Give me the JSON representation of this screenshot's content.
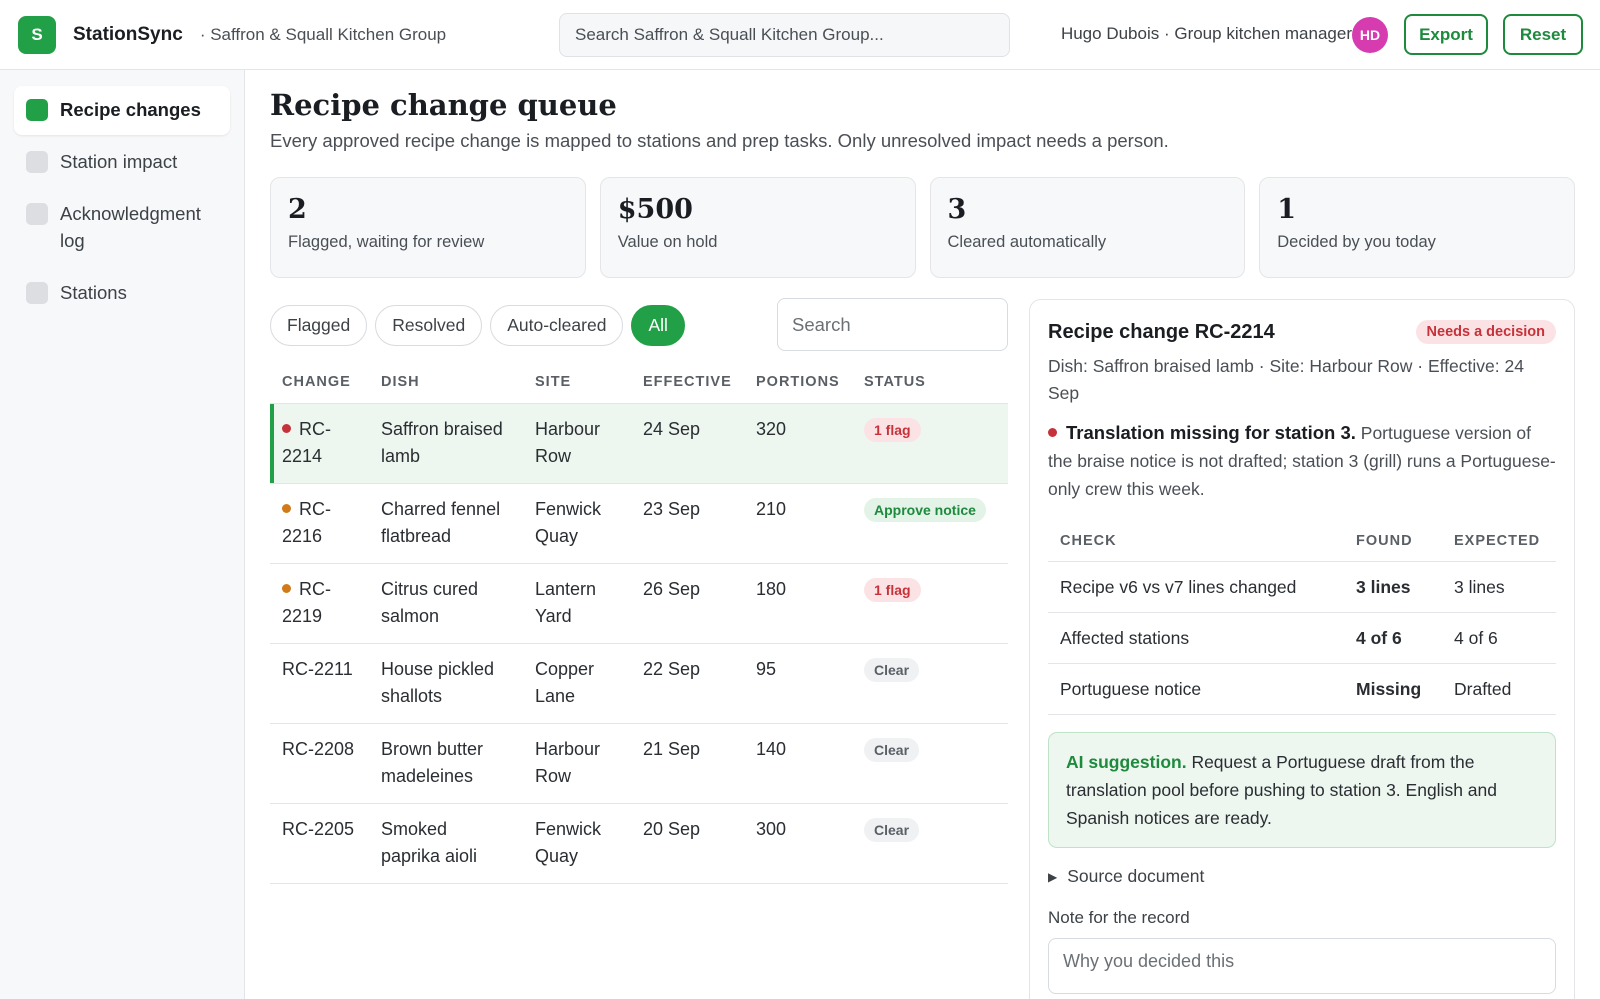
{
  "app": {
    "logo_letter": "S",
    "name": "StationSync",
    "org": "· Saffron & Squall Kitchen Group",
    "search_placeholder": "Search Saffron & Squall Kitchen Group...",
    "user": "Hugo Dubois · Group kitchen manager",
    "avatar_initials": "HD",
    "export_label": "Export",
    "reset_label": "Reset",
    "accent_color": "#22a047",
    "avatar_color": "#d63bb0"
  },
  "sidebar": {
    "items": [
      {
        "label": "Recipe changes",
        "active": true
      },
      {
        "label": "Station impact",
        "active": false
      },
      {
        "label": "Acknowledgment log",
        "active": false
      },
      {
        "label": "Stations",
        "active": false
      }
    ]
  },
  "main": {
    "title": "Recipe change queue",
    "subtitle": "Every approved recipe change is mapped to stations and prep tasks. Only unresolved impact needs a person.",
    "stats": [
      {
        "value": "2",
        "label": "Flagged, waiting for review"
      },
      {
        "value": "$500",
        "label": "Value on hold"
      },
      {
        "value": "3",
        "label": "Cleared automatically"
      },
      {
        "value": "1",
        "label": "Decided by you today"
      }
    ],
    "filters": [
      "Flagged",
      "Resolved",
      "Auto-cleared",
      "All"
    ],
    "active_filter": "All",
    "search_placeholder": "Search",
    "columns": [
      "CHANGE",
      "DISH",
      "SITE",
      "EFFECTIVE",
      "PORTIONS",
      "STATUS"
    ],
    "rows": [
      {
        "change": "RC-2214",
        "dish": "Saffron braised lamb",
        "site": "Harbour Row",
        "effective": "24 Sep",
        "portions": "320",
        "status": "1 flag",
        "status_kind": "flag",
        "dot": "red",
        "selected": true
      },
      {
        "change": "RC-2216",
        "dish": "Charred fennel flatbread",
        "site": "Fenwick Quay",
        "effective": "23 Sep",
        "portions": "210",
        "status": "Approve notice",
        "status_kind": "approve",
        "dot": "orange",
        "selected": false
      },
      {
        "change": "RC-2219",
        "dish": "Citrus cured salmon",
        "site": "Lantern Yard",
        "effective": "26 Sep",
        "portions": "180",
        "status": "1 flag",
        "status_kind": "flag",
        "dot": "orange",
        "selected": false
      },
      {
        "change": "RC-2211",
        "dish": "House pickled shallots",
        "site": "Copper Lane",
        "effective": "22 Sep",
        "portions": "95",
        "status": "Clear",
        "status_kind": "clear",
        "dot": "",
        "selected": false
      },
      {
        "change": "RC-2208",
        "dish": "Brown butter madeleines",
        "site": "Harbour Row",
        "effective": "21 Sep",
        "portions": "140",
        "status": "Clear",
        "status_kind": "clear",
        "dot": "",
        "selected": false
      },
      {
        "change": "RC-2205",
        "dish": "Smoked paprika aioli",
        "site": "Fenwick Quay",
        "effective": "20 Sep",
        "portions": "300",
        "status": "Clear",
        "status_kind": "clear",
        "dot": "",
        "selected": false
      }
    ]
  },
  "detail": {
    "title": "Recipe change RC-2214",
    "badge": "Needs a decision",
    "meta": "Dish: Saffron braised lamb · Site: Harbour Row · Effective: 24 Sep",
    "issue_title": "Translation missing for station 3.",
    "issue_body": "Portuguese version of the braise notice is not drafted; station 3 (grill) runs a Portuguese-only crew this week.",
    "check_columns": [
      "CHECK",
      "FOUND",
      "EXPECTED"
    ],
    "checks": [
      {
        "check": "Recipe v6 vs v7 lines changed",
        "found": "3 lines",
        "expected": "3 lines",
        "ok": true
      },
      {
        "check": "Affected stations",
        "found": "4 of 6",
        "expected": "4 of 6",
        "ok": true
      },
      {
        "check": "Portuguese notice",
        "found": "Missing",
        "expected": "Drafted",
        "ok": false
      }
    ],
    "ai_label": "AI suggestion.",
    "ai_text": "Request a Portuguese draft from the translation pool before pushing to station 3. English and Spanish notices are ready.",
    "source_label": "Source document",
    "note_label": "Note for the record",
    "note_placeholder": "Why you decided this"
  }
}
